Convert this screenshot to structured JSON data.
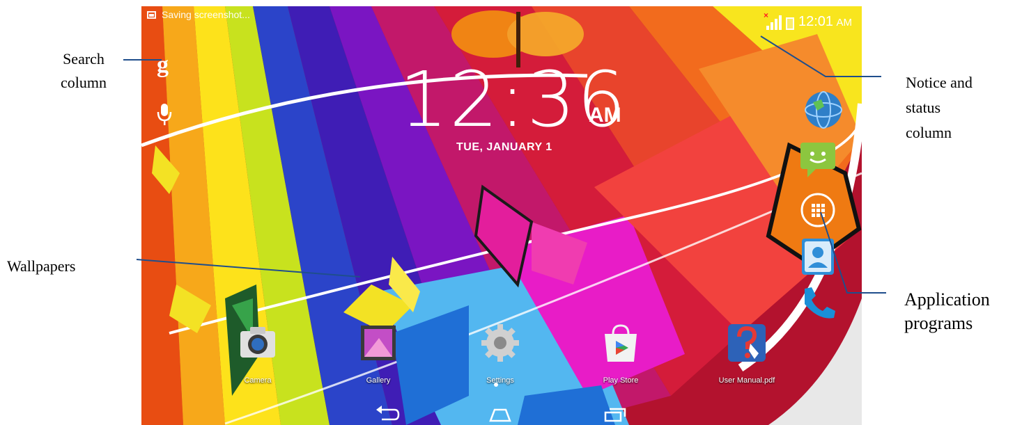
{
  "annotations": {
    "search": [
      "Search",
      "column"
    ],
    "wallpapers": "Wallpapers",
    "notice": [
      "Notice and",
      "status",
      "column"
    ],
    "apps": [
      "Application",
      "programs"
    ]
  },
  "status_bar": {
    "notification": "Saving screenshot...",
    "time": "12:01",
    "ampm": "AM",
    "no_signal_mark": "×"
  },
  "search_bar": {
    "google_glyph": "g"
  },
  "clock": {
    "time": "12:36",
    "ampm": "AM",
    "date": "TUE, JANUARY 1"
  },
  "dock": {
    "apps": [
      {
        "label": "Camera",
        "icon": "camera-icon"
      },
      {
        "label": "Gallery",
        "icon": "gallery-icon"
      },
      {
        "label": "Settings",
        "icon": "gear-icon"
      },
      {
        "label": "Play Store",
        "icon": "play-store-icon"
      },
      {
        "label": "User Manual.pdf",
        "icon": "help-document-icon"
      }
    ]
  },
  "side_apps": [
    "browser-globe-icon",
    "messaging-icon",
    "app-drawer-icon",
    "contacts-icon",
    "phone-icon"
  ],
  "nav": [
    "back-icon",
    "home-icon",
    "recents-icon"
  ],
  "colors": {
    "lines": "#1f4e8c",
    "wallpaper_base": "#b3122e"
  }
}
